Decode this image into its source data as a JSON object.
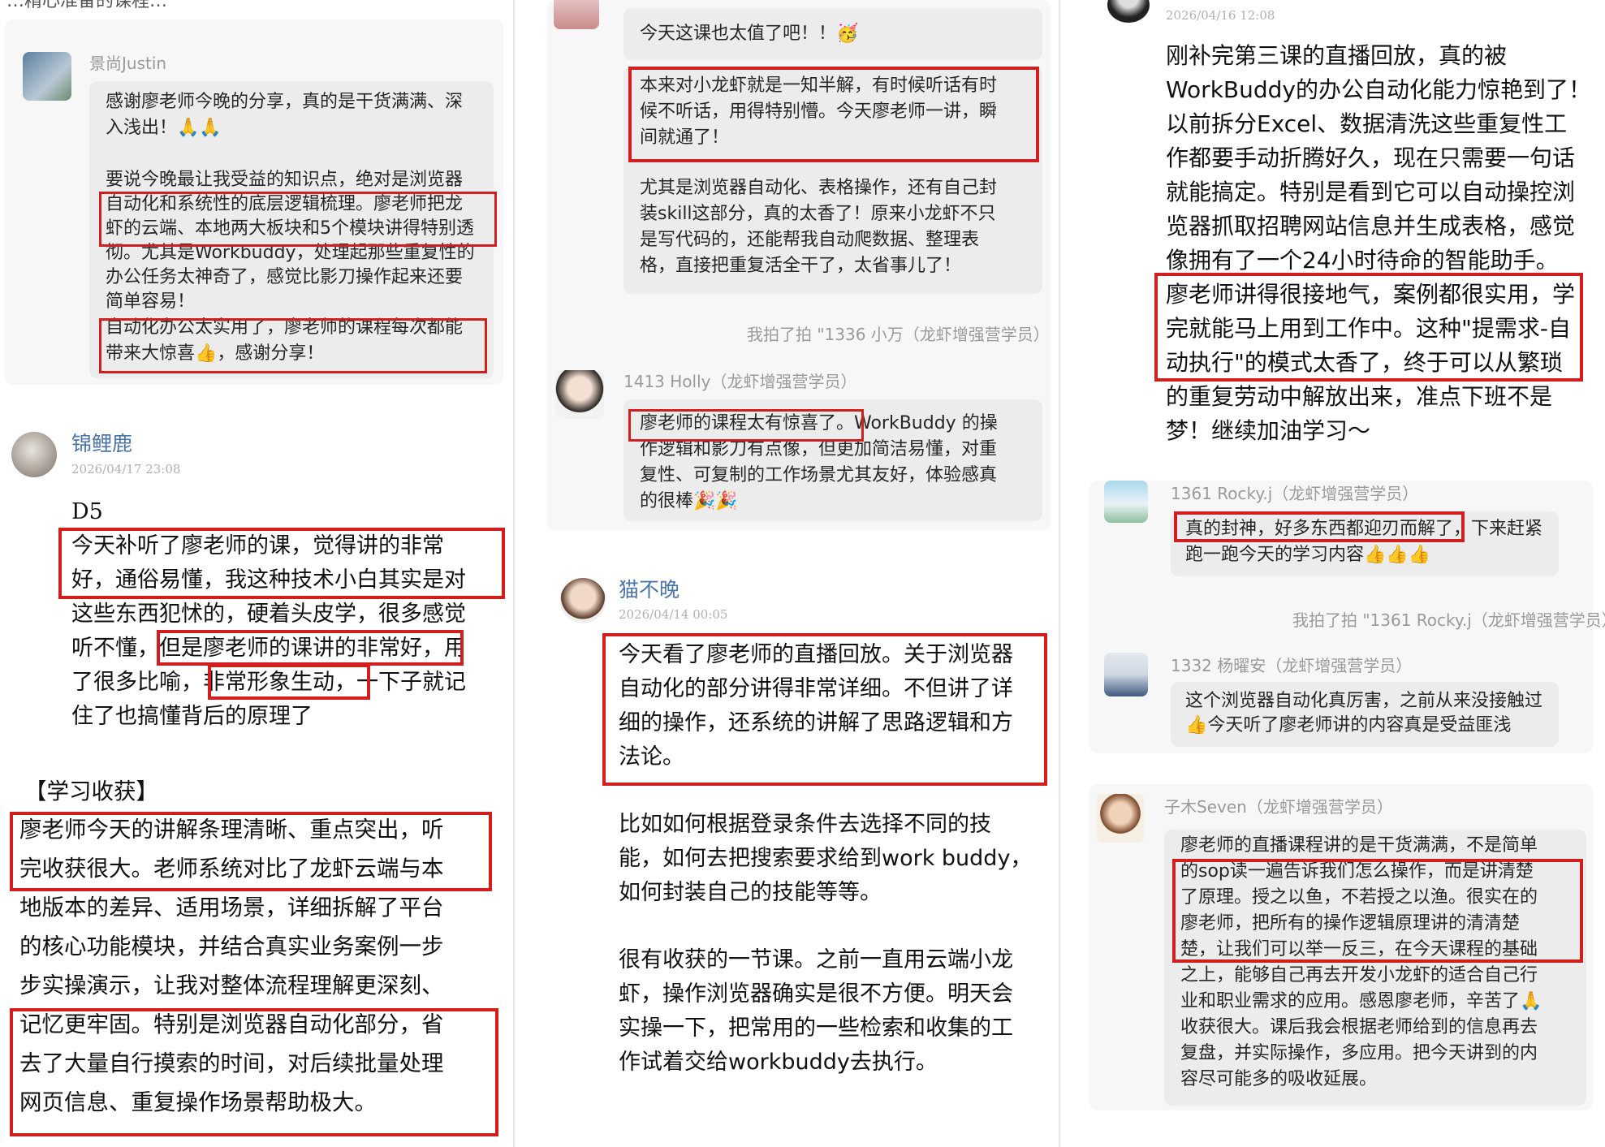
{
  "col1": {
    "top_partial": "…精心准备的课程…",
    "comment1": {
      "username": "景尚Justin",
      "lines": [
        "感谢廖老师今晚的分享，真的是干货满满、深",
        "入浅出！🙏🙏",
        "",
        "要说今晚最让我受益的知识点，绝对是浏览器",
        "自动化和系统性的底层逻辑梳理。廖老师把龙",
        "虾的云端、本地两大板块和5个模块讲得特别透",
        "彻。尤其是Workbuddy，处理起那些重复性的",
        "办公任务太神奇了，感觉比影刀操作起来还要",
        "简单容易！",
        "自动化办公太实用了，廖老师的课程每次都能",
        "带来大惊喜👍，感谢分享！"
      ]
    },
    "comment2": {
      "username": "锦鲤鹿",
      "date": "2026/04/17 23:08",
      "lines": [
        "D5",
        "今天补听了廖老师的课，觉得讲的非常",
        "好，通俗易懂，我这种技术小白其实是对",
        "这些东西犯怵的，硬着头皮学，很多感觉",
        "听不懂，但是廖老师的课讲的非常好，用",
        "了很多比喻，非常形象生动，一下子就记",
        "住了也搞懂背后的原理了",
        "",
        "【学习收获】",
        "廖老师今天的讲解条理清晰、重点突出，听",
        "完收获很大。老师系统对比了龙虾云端与本",
        "地版本的差异、适用场景，详细拆解了平台",
        "的核心功能模块，并结合真实业务案例一步",
        "步实操演示，让我对整体流程理解更深刻、",
        "记忆更牢固。特别是浏览器自动化部分，省",
        "去了大量自行摸索的时间，对后续批量处理",
        "网页信息、重复操作场景帮助极大。"
      ]
    }
  },
  "col2": {
    "comment1": {
      "b1": "今天这课也太值了吧！！🥳",
      "b2": [
        "本来对小龙虾就是一知半解，有时候听话有时",
        "候不听话，用得特别懵。今天廖老师一讲，瞬",
        "间就通了！",
        "",
        "尤其是浏览器自动化、表格操作，还有自己封",
        "装skill这部分，真的太香了！原来小龙虾不只",
        "是写代码的，还能帮我自动爬数据、整理表",
        "格，直接把重复活全干了，太省事儿了！"
      ]
    },
    "pat1": "我拍了拍 \"1336 小万（龙虾增强营学员）",
    "comment2": {
      "username": "1413  Holly（龙虾增强营学员）",
      "lines": [
        "廖老师的课程太有惊喜了。WorkBuddy 的操",
        "作逻辑和影刀有点像，但更加简洁易懂，对重",
        "复性、可复制的工作场景尤其友好，体验感真",
        "的很棒🎉🎉"
      ]
    },
    "comment3": {
      "username": "猫不晚",
      "date": "2026/04/14 00:05",
      "lines": [
        "今天看了廖老师的直播回放。关于浏览器",
        "自动化的部分讲得非常详细。不但讲了详",
        "细的操作，还系统的讲解了思路逻辑和方",
        "法论。",
        "",
        "比如如何根据登录条件去选择不同的技",
        "能，如何去把搜索要求给到work buddy，",
        "如何封装自己的技能等等。",
        "",
        "很有收获的一节课。之前一直用云端小龙",
        "虾，操作浏览器确实是很不方便。明天会",
        "实操一下，把常用的一些检索和收集的工",
        "作试着交给workbuddy去执行。"
      ]
    }
  },
  "col3": {
    "comment1": {
      "date": "2026/04/16 12:08",
      "lines": [
        "刚补完第三课的直播回放，真的被",
        "WorkBuddy的办公自动化能力惊艳到了！",
        "以前拆分Excel、数据清洗这些重复性工",
        "作都要手动折腾好久，现在只需要一句话",
        "就能搞定。特别是看到它可以自动操控浏",
        "览器抓取招聘网站信息并生成表格，感觉",
        "像拥有了一个24小时待命的智能助手。",
        "廖老师讲得很接地气，案例都很实用，学",
        "完就能马上用到工作中。这种\"提需求-自",
        "动执行\"的模式太香了，终于可以从繁琐",
        "的重复劳动中解放出来，准点下班不是",
        "梦！继续加油学习～"
      ]
    },
    "comment2": {
      "username": "1361 Rocky.j（龙虾增强营学员）",
      "lines": [
        "真的封神，好多东西都迎刃而解了，下来赶紧",
        "跑一跑今天的学习内容👍👍👍"
      ]
    },
    "pat2": "我拍了拍 \"1361 Rocky.j（龙虾增强营学员）",
    "comment3": {
      "username": "1332 杨曜安（龙虾增强营学员）",
      "lines": [
        "这个浏览器自动化真厉害，之前从来没接触过",
        "👍今天听了廖老师讲的内容真是受益匪浅"
      ]
    },
    "comment4": {
      "username": "子木Seven（龙虾增强营学员）",
      "lines": [
        "廖老师的直播课程讲的是干货满满，不是简单",
        "的sop读一遍告诉我们怎么操作，而是讲清楚",
        "了原理。授之以鱼，不若授之以渔。很实在的",
        "廖老师，把所有的操作逻辑原理讲的清清楚",
        "楚，让我们可以举一反三，在今天课程的基础",
        "之上，能够自己再去开发小龙虾的适合自己行",
        "业和职业需求的应用。感恩廖老师，辛苦了🙏",
        "收获很大。课后我会根据老师给到的信息再去",
        "复盘，并实际操作，多应用。把今天讲到的内",
        "容尽可能多的吸收延展。"
      ]
    }
  }
}
